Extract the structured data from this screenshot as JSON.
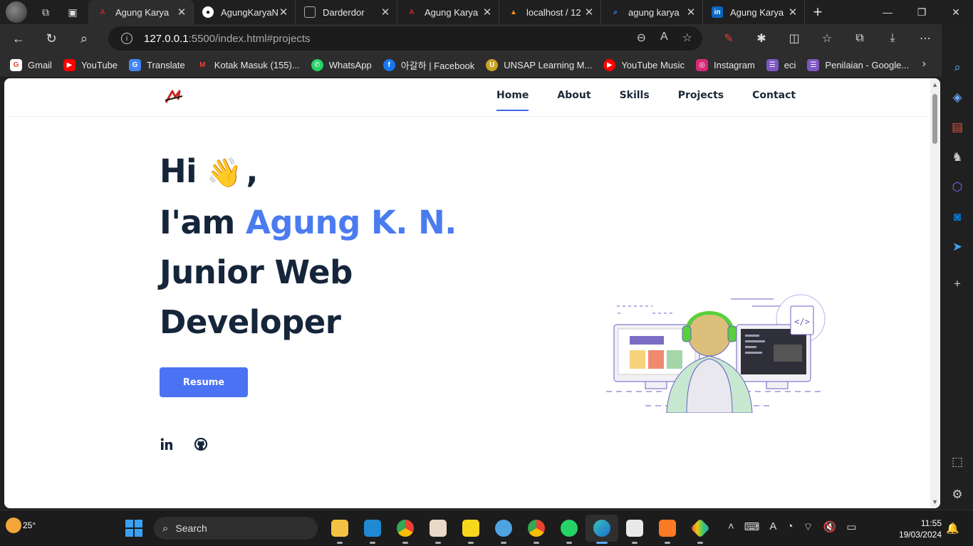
{
  "browser": {
    "tabs": [
      {
        "title": "Agung Karya",
        "favicon_color": "#c62828",
        "active": true
      },
      {
        "title": "AgungKaryaN",
        "favicon_color": "#ffffff"
      },
      {
        "title": "Darderdor",
        "favicon_color": "#9e9e9e"
      },
      {
        "title": "Agung Karya",
        "favicon_color": "#c62828"
      },
      {
        "title": "localhost / 12",
        "favicon_color": "#f29111"
      },
      {
        "title": "agung karya",
        "favicon_color": "#4285f4"
      },
      {
        "title": "Agung Karya",
        "favicon_color": "#0a66c2"
      }
    ],
    "url_host": "127.0.0.1",
    "url_path": ":5500/index.html#projects",
    "bookmarks": [
      {
        "label": "Gmail",
        "color": "#ea4335"
      },
      {
        "label": "YouTube",
        "color": "#ff0000"
      },
      {
        "label": "Translate",
        "color": "#4285f4"
      },
      {
        "label": "Kotak Masuk (155)...",
        "color": "#d93025"
      },
      {
        "label": "WhatsApp",
        "color": "#25d366"
      },
      {
        "label": "아갈하 | Facebook",
        "color": "#1877f2"
      },
      {
        "label": "UNSAP Learning M...",
        "color": "#c9a227"
      },
      {
        "label": "YouTube Music",
        "color": "#ff0000"
      },
      {
        "label": "Instagram",
        "color": "#d62976"
      },
      {
        "label": "eci",
        "color": "#7e57c2"
      },
      {
        "label": "Penilaian - Google...",
        "color": "#7e57c2"
      }
    ]
  },
  "site": {
    "nav": [
      "Home",
      "About",
      "Skills",
      "Projects",
      "Contact"
    ],
    "active_nav": "Home",
    "hero": {
      "greeting": "Hi",
      "wave": "👋",
      "comma": ",",
      "iam": "I'am",
      "name": "Agung K. N.",
      "role_line1": "Junior Web",
      "role_line2": "Developer"
    },
    "resume_label": "Resume",
    "accent_color": "#4a72f3"
  },
  "taskbar": {
    "temperature": "25°",
    "search_placeholder": "Search",
    "time": "11:55",
    "date": "19/03/2024"
  }
}
